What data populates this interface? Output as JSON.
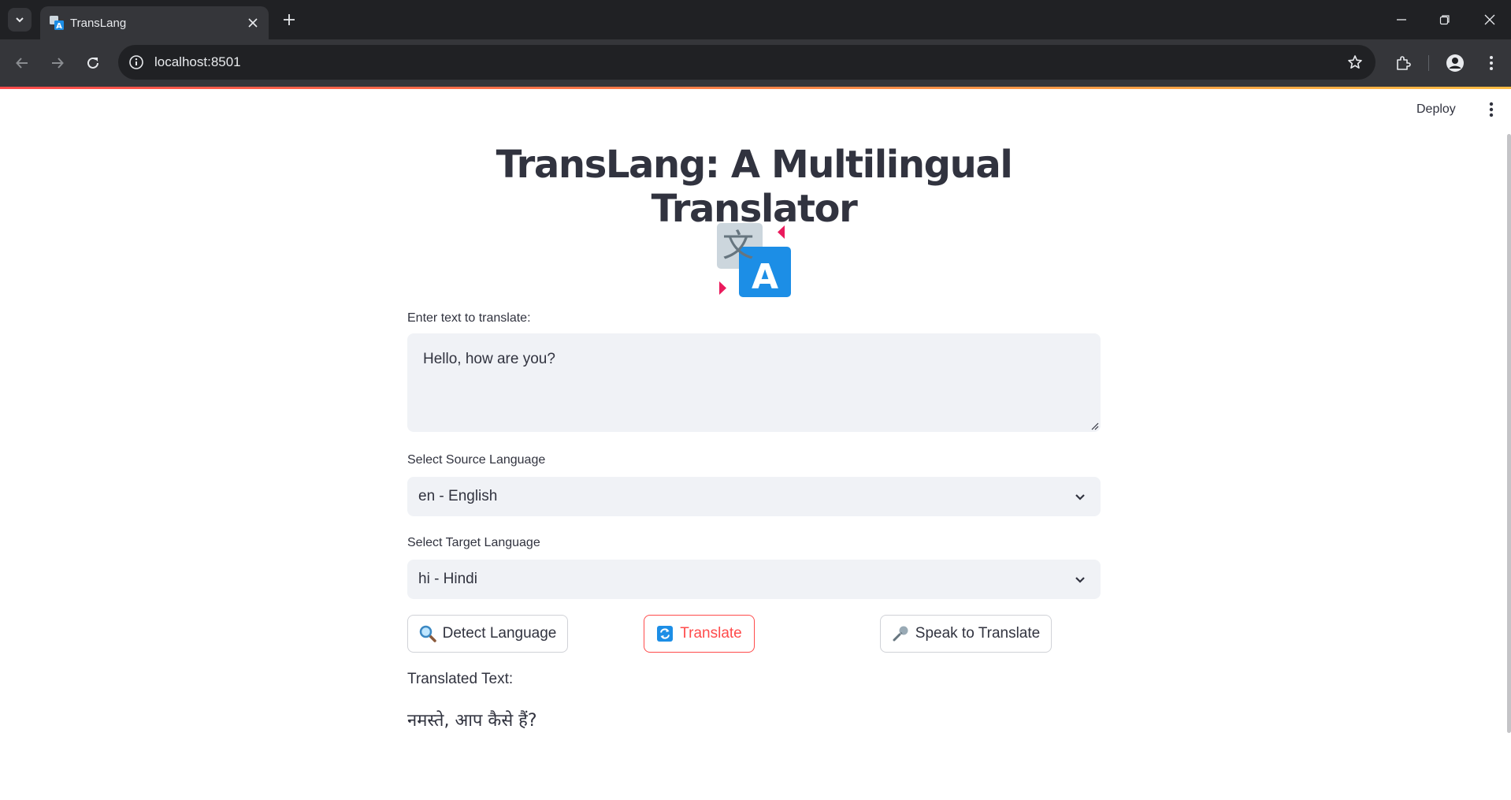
{
  "browser": {
    "tab_title": "TransLang",
    "url": "localhost:8501",
    "colors": {
      "frame": "#202124",
      "toolbar": "#35363a"
    }
  },
  "app": {
    "deploy_label": "Deploy",
    "title": "TransLang: A Multilingual Translator",
    "logo_icon": "translate-emoji",
    "input": {
      "label": "Enter text to translate:",
      "value": "Hello, how are you?"
    },
    "source": {
      "label": "Select Source Language",
      "value": "en - English"
    },
    "target": {
      "label": "Select Target Language",
      "value": "hi - Hindi"
    },
    "buttons": {
      "detect": "Detect Language",
      "translate": "Translate",
      "speak": "Speak to Translate"
    },
    "result": {
      "label": "Translated Text:",
      "text": "नमस्ते, आप कैसे हैं?"
    },
    "colors": {
      "primary": "#ff4b4b",
      "text": "#31333f",
      "input_bg": "#f0f2f6"
    }
  }
}
